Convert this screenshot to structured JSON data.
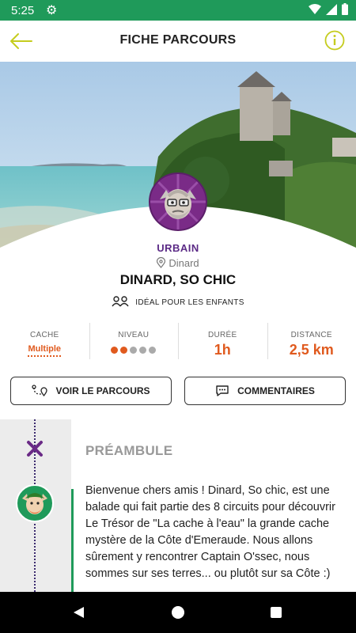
{
  "status_bar": {
    "time": "5:25"
  },
  "app_bar": {
    "title": "FICHE PARCOURS"
  },
  "parcours": {
    "category": "URBAIN",
    "location": "Dinard",
    "name": "DINARD, SO CHIC",
    "kids_label": "IDÉAL POUR LES ENFANTS"
  },
  "stats": [
    {
      "label": "CACHE",
      "value": "Multiple"
    },
    {
      "label": "NIVEAU",
      "value_level": 2,
      "max_level": 5
    },
    {
      "label": "DURÉE",
      "value": "1h"
    },
    {
      "label": "DISTANCE",
      "value": "2,5 km"
    }
  ],
  "buttons": {
    "route_label": "VOIR LE PARCOURS",
    "comments_label": "COMMENTAIRES"
  },
  "preamble": {
    "title": "PRÉAMBULE",
    "text": "Bienvenue chers amis ! Dinard, So chic, est une balade qui fait partie des 8 circuits pour découvrir Le Trésor de \"La cache à l'eau\" la grande cache mystère de la Côte d'Emeraude. Nous allons sûrement y rencontrer Captain O'ssec, nous sommes sur ses terres... ou plutôt sur sa Côte :)"
  },
  "colors": {
    "accent_green": "#1f9a5a",
    "accent_orange": "#e05a1e",
    "category_purple": "#5b2a86",
    "icon_yellow_green": "#c5cc1e"
  },
  "icons": [
    "back-arrow-icon",
    "info-icon",
    "map-pin-icon",
    "kids-icon",
    "route-icon",
    "comment-icon",
    "cross-marker-icon"
  ]
}
